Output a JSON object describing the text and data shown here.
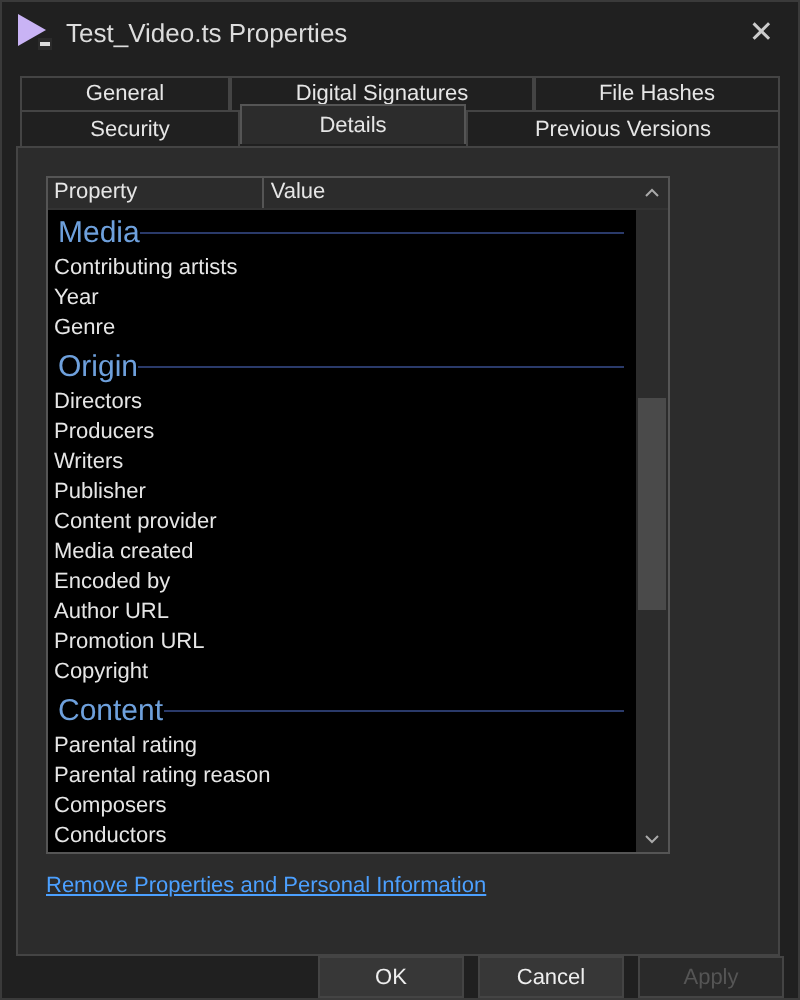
{
  "window": {
    "title": "Test_Video.ts Properties",
    "close": "✕"
  },
  "tab_rows": [
    [
      {
        "label": "General",
        "selected": false
      },
      {
        "label": "Digital Signatures",
        "selected": false
      },
      {
        "label": "File Hashes",
        "selected": false
      }
    ],
    [
      {
        "label": "Security",
        "selected": false
      },
      {
        "label": "Details",
        "selected": true
      },
      {
        "label": "Previous Versions",
        "selected": false
      }
    ]
  ],
  "table": {
    "columns": [
      "Property",
      "Value"
    ],
    "groups": [
      {
        "heading": "Media",
        "items": [
          "Contributing artists",
          "Year",
          "Genre"
        ]
      },
      {
        "heading": "Origin",
        "items": [
          "Directors",
          "Producers",
          "Writers",
          "Publisher",
          "Content provider",
          "Media created",
          "Encoded by",
          "Author URL",
          "Promotion URL",
          "Copyright"
        ]
      },
      {
        "heading": "Content",
        "items": [
          "Parental rating",
          "Parental rating reason",
          "Composers",
          "Conductors"
        ]
      }
    ]
  },
  "link": "Remove Properties and Personal Information",
  "buttons": [
    {
      "label": "OK",
      "disabled": false
    },
    {
      "label": "Cancel",
      "disabled": false
    },
    {
      "label": "Apply",
      "disabled": true
    }
  ]
}
